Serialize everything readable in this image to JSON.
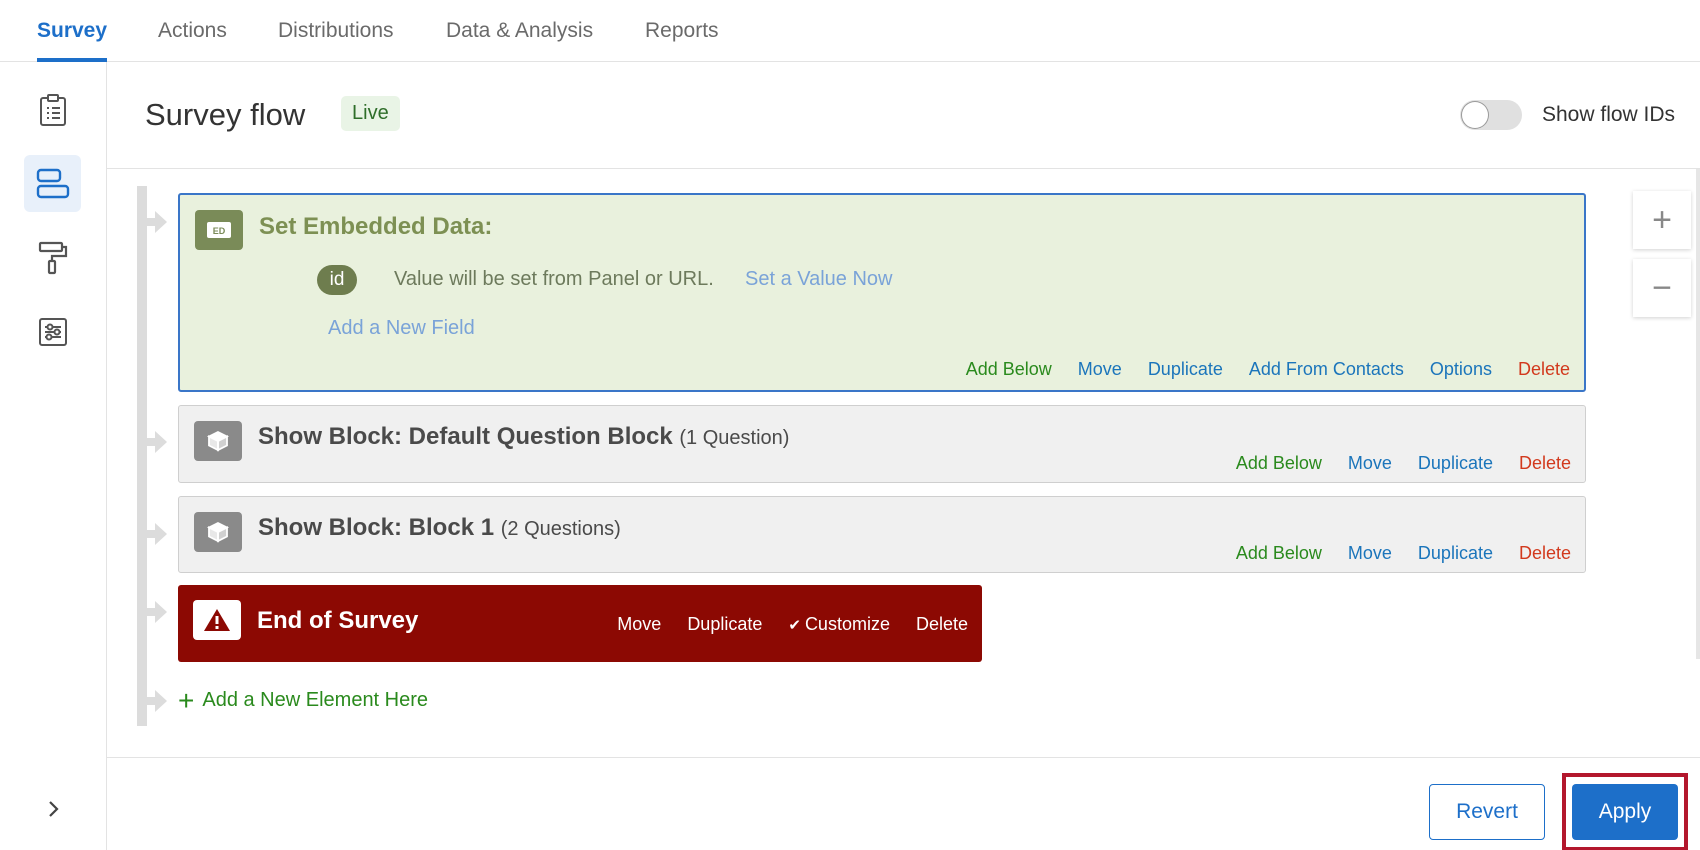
{
  "nav": {
    "tabs": [
      {
        "label": "Survey"
      },
      {
        "label": "Actions"
      },
      {
        "label": "Distributions"
      },
      {
        "label": "Data & Analysis"
      },
      {
        "label": "Reports"
      }
    ],
    "active_tab": "Survey"
  },
  "rail": {
    "items": [
      {
        "icon": "clipboard-icon"
      },
      {
        "icon": "survey-flow-icon"
      },
      {
        "icon": "paint-roller-icon"
      },
      {
        "icon": "options-sliders-icon"
      }
    ],
    "active_icon": "survey-flow-icon",
    "expand_icon": "chevron-right-icon"
  },
  "header": {
    "title": "Survey flow",
    "status_badge": "Live",
    "toggle_label": "Show flow IDs",
    "toggle_on": false
  },
  "embedded_block": {
    "icon_label": "ED",
    "title": "Set Embedded Data:",
    "field_name": "id",
    "field_description": "Value will be set from Panel or URL.",
    "set_value_link": "Set a Value Now",
    "add_field_link": "Add a New Field",
    "actions": {
      "add_below": "Add Below",
      "move": "Move",
      "duplicate": "Duplicate",
      "add_from_contacts": "Add From Contacts",
      "options": "Options",
      "delete": "Delete"
    }
  },
  "show_blocks": [
    {
      "title": "Show Block: Default Question Block",
      "count": "(1 Question)",
      "actions": {
        "add_below": "Add Below",
        "move": "Move",
        "duplicate": "Duplicate",
        "delete": "Delete"
      }
    },
    {
      "title": "Show Block: Block 1",
      "count": "(2 Questions)",
      "actions": {
        "add_below": "Add Below",
        "move": "Move",
        "duplicate": "Duplicate",
        "delete": "Delete"
      }
    }
  ],
  "end_block": {
    "title": "End of Survey",
    "actions": {
      "move": "Move",
      "duplicate": "Duplicate",
      "customize": "Customize",
      "delete": "Delete"
    }
  },
  "add_element": "Add a New Element Here",
  "zoom": {
    "in": "+",
    "out": "−"
  },
  "footer": {
    "revert": "Revert",
    "apply": "Apply"
  },
  "colors": {
    "brand_blue": "#1d6fc9",
    "embedded_bg": "#e9f1dd",
    "end_bg": "#8c0903",
    "action_green": "#2a8a1d",
    "action_red": "#d2391d",
    "highlight_red": "#b3172d"
  }
}
